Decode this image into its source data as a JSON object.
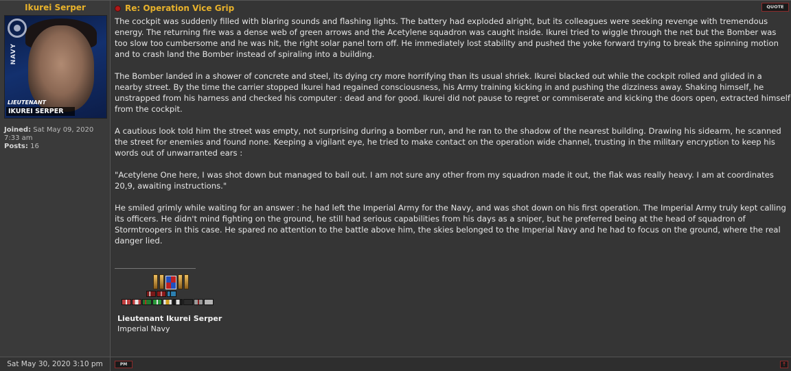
{
  "author": {
    "name": "Ikurei Serper",
    "avatar_vertical_text": "NAVY",
    "avatar_rank": "LIEUTENANT",
    "avatar_nameplate": "IKUREI SERPER",
    "joined_label": "Joined:",
    "joined_value": "Sat May 09, 2020 7:33 am",
    "posts_label": "Posts:",
    "posts_value": "16"
  },
  "post": {
    "title": "Re: Operation Vice Grip",
    "quote_label": "QUOTE",
    "paragraphs": [
      "The cockpit was suddenly filled with blaring sounds and flashing lights. The battery had exploded alright, but its colleagues were seeking revenge with tremendous energy. The returning fire was a dense web of green arrows and the Acetylene squadron was caught inside. Ikurei tried to wiggle through the net but the Bomber was too slow too cumbersome and he was hit, the right solar panel torn off. He immediately lost stability and pushed the yoke forward trying to break the spinning motion and to crash land the Bomber instead of spiraling into a building.",
      "The Bomber landed in a shower of concrete and steel, its dying cry more horrifying than its usual shriek. Ikurei blacked out while the cockpit rolled and glided in a nearby street. By the time the carrier stopped Ikurei had regained consciousness, his Army training kicking in and pushing the dizziness away. Shaking himself, he unstrapped from his harness and checked his computer : dead and for good. Ikurei did not pause to regret or commiserate and kicking the doors open, extracted himself from the cockpit.",
      "A cautious look told him the street was empty, not surprising during a bomber run, and he ran to the shadow of the nearest building. Drawing his sidearm, he scanned the street for enemies and found none. Keeping a vigilant eye, he tried to make contact on the operation wide channel, trusting in the military encryption to keep his words out of unwarranted ears :",
      "\"Acetylene One here, I was shot down but managed to bail out. I am not sure any other from my squadron made it out, the flak was really heavy. I am at coordinates 20,9, awaiting instructions.\"",
      "He smiled grimly while waiting for an answer : he had left the Imperial Army for the Navy, and was shot down on his first operation. The Imperial Army truly kept calling its officers. He didn't mind fighting on the ground, he still had serious capabilities from his days as a sniper, but he preferred being at the head of squadron of Stormtroopers in this case. He spared no attention to the battle above him, the skies belonged to the Imperial Navy and he had to focus on the ground, where the real danger lied."
    ]
  },
  "signature": {
    "name": "Lieutenant Ikurei Serper",
    "branch": "Imperial Navy"
  },
  "footer": {
    "date": "Sat May 30, 2020 3:10 pm",
    "pm_label": "PM",
    "top_label": "↑"
  },
  "colors": {
    "accent": "#e8b22b",
    "button_border": "#8c2a2a",
    "background": "#353535"
  }
}
